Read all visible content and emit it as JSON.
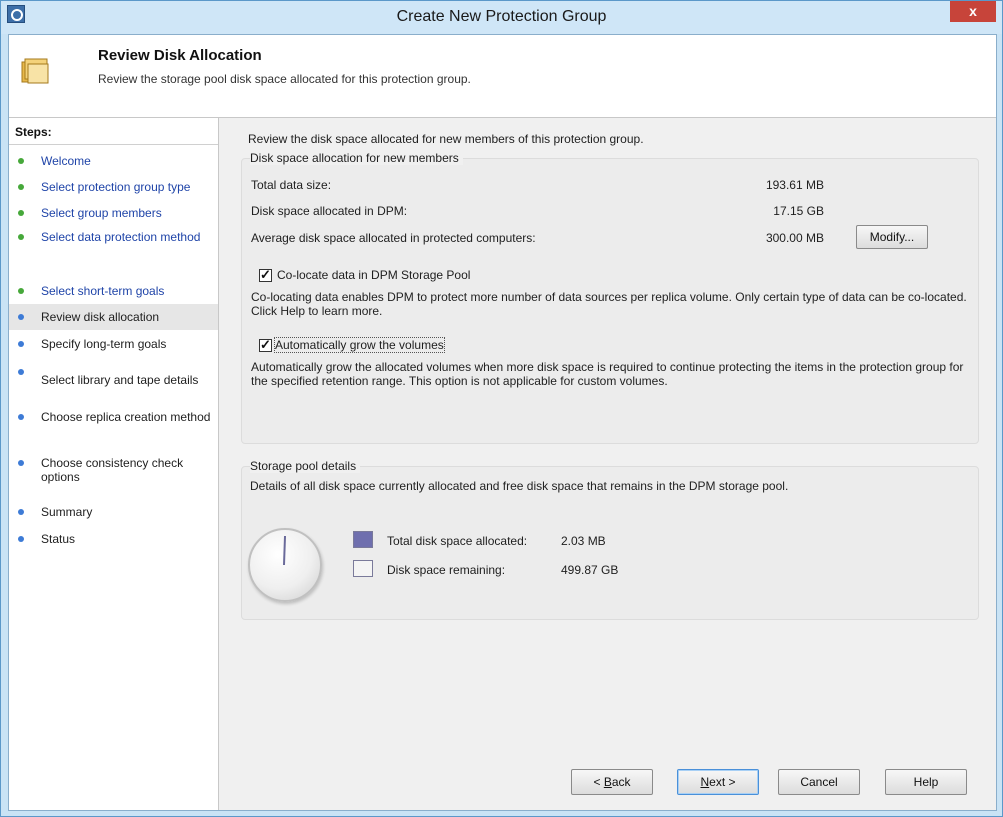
{
  "window": {
    "title": "Create New Protection Group",
    "close_label": "x"
  },
  "header": {
    "title": "Review Disk Allocation",
    "subtitle": "Review the storage pool disk space allocated for this protection group."
  },
  "steps": {
    "title": "Steps:",
    "items": [
      {
        "label": "Welcome",
        "state": "done"
      },
      {
        "label": "Select protection group type",
        "state": "done"
      },
      {
        "label": "Select group members",
        "state": "done"
      },
      {
        "label": "Select data protection method",
        "state": "done"
      },
      {
        "label": "Select short-term goals",
        "state": "done"
      },
      {
        "label": "Review disk allocation",
        "state": "current"
      },
      {
        "label": "Specify long-term goals",
        "state": "pending"
      },
      {
        "label": "Select library and tape details",
        "state": "pending"
      },
      {
        "label": "Choose replica creation method",
        "state": "pending"
      },
      {
        "label": "Choose consistency check options",
        "state": "pending"
      },
      {
        "label": "Summary",
        "state": "pending"
      },
      {
        "label": "Status",
        "state": "pending"
      }
    ]
  },
  "main": {
    "intro": "Review the disk space allocated for new members of this protection group.",
    "allocation": {
      "title": "Disk space allocation for new members",
      "rows": [
        {
          "label": "Total data size:",
          "value": "193.61 MB"
        },
        {
          "label": "Disk space allocated in DPM:",
          "value": "17.15 GB"
        },
        {
          "label": "Average disk space allocated in protected computers:",
          "value": "300.00 MB"
        }
      ],
      "modify_label": "Modify...",
      "colocate": {
        "label": "Co-locate data in DPM Storage Pool",
        "checked": true,
        "description": "Co-locating data enables DPM to protect more number of data sources per replica volume. Only certain type of data can be co-located. Click Help to learn more."
      },
      "autogrow": {
        "label": "Automatically grow the volumes",
        "checked": true,
        "description": "Automatically grow the allocated volumes when more disk space is required to continue protecting the items in the protection group for the specified retention range. This option is not applicable for custom volumes."
      }
    },
    "storage_pool": {
      "title": "Storage pool details",
      "description": "Details of all disk space currently allocated and free disk space that remains in the DPM storage pool.",
      "legend": [
        {
          "label": "Total disk space allocated:",
          "value": "2.03 MB",
          "color": "#6f6fae"
        },
        {
          "label": "Disk space remaining:",
          "value": "499.87 GB",
          "color": "#f4f4f4"
        }
      ]
    }
  },
  "footer": {
    "back_label": "< Back",
    "next_label": "Next >",
    "cancel_label": "Cancel",
    "help_label": "Help"
  }
}
